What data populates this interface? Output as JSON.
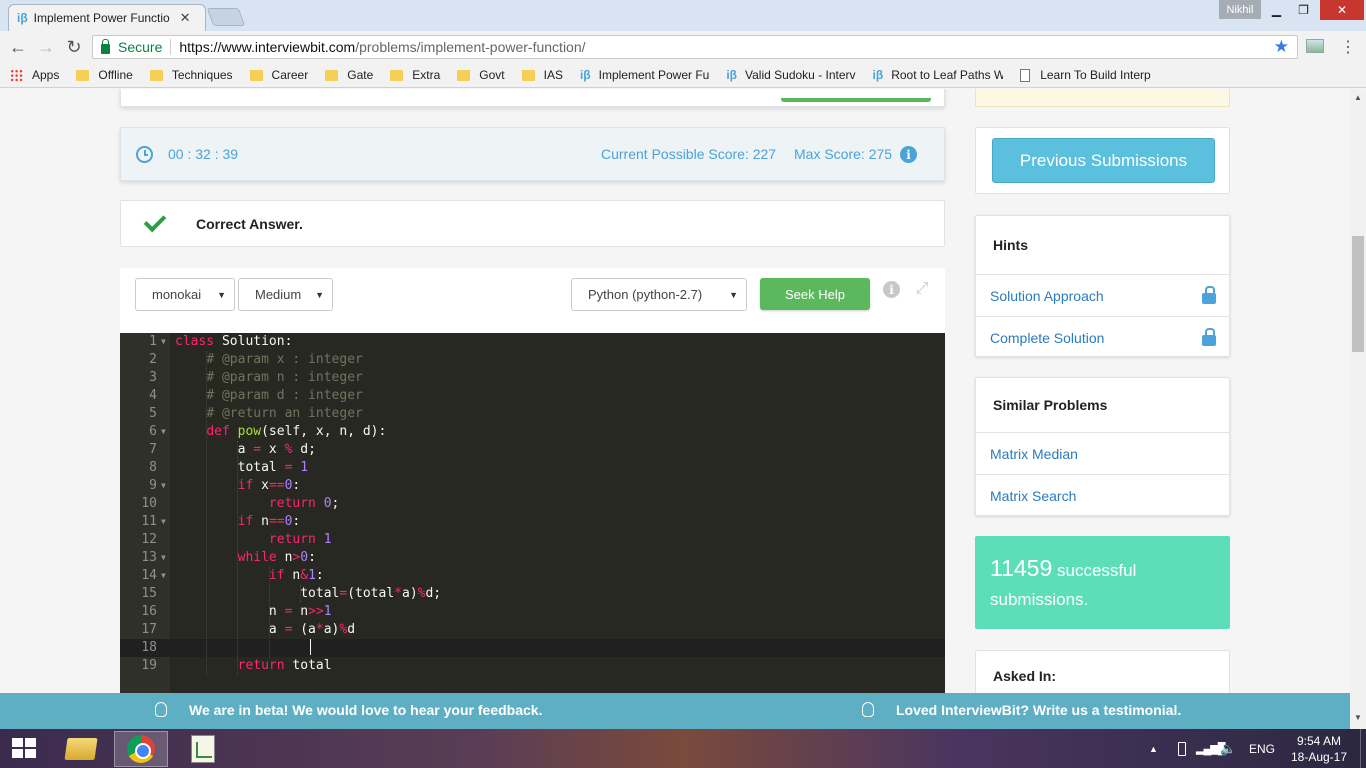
{
  "browser": {
    "tab_title": "Implement Power Functio",
    "tab_favicon": "iβ",
    "user_name": "Nikhil",
    "window_buttons": {
      "minimize": "▁",
      "maximize": "❐",
      "close": "✕"
    },
    "secure_label": "Secure",
    "url_host": "https://www.interviewbit.com",
    "url_path": "/problems/implement-power-function/",
    "bookmarks": [
      {
        "label": "Apps",
        "icon": "apps-icon"
      },
      {
        "label": "Offline",
        "icon": "folder-icon"
      },
      {
        "label": "Techniques",
        "icon": "folder-icon"
      },
      {
        "label": "Career",
        "icon": "folder-icon"
      },
      {
        "label": "Gate",
        "icon": "folder-icon"
      },
      {
        "label": "Extra",
        "icon": "folder-icon"
      },
      {
        "label": "Govt",
        "icon": "folder-icon"
      },
      {
        "label": "IAS",
        "icon": "folder-icon"
      },
      {
        "label": "Implement Power Fu",
        "icon": "ib-icon"
      },
      {
        "label": "Valid Sudoku - Interv",
        "icon": "ib-icon"
      },
      {
        "label": "Root to Leaf Paths W",
        "icon": "ib-icon"
      },
      {
        "label": "Learn To Build Interp",
        "icon": "page-icon"
      }
    ]
  },
  "timer": {
    "time": "00 : 32 : 39",
    "current_score": "Current Possible Score: 227",
    "max_score": "Max Score: 275"
  },
  "result": {
    "message": "Correct Answer."
  },
  "editor": {
    "theme": "monokai",
    "font_size": "Medium",
    "language": "Python (python-2.7)",
    "seek_help": "Seek Help",
    "lines": [
      "class Solution:",
      "    # @param x : integer",
      "    # @param n : integer",
      "    # @param d : integer",
      "    # @return an integer",
      "    def pow(self, x, n, d):",
      "        a = x % d;",
      "        total = 1",
      "        if x==0:",
      "            return 0;",
      "        if n==0:",
      "            return 1",
      "        while n>0:",
      "            if n&1:",
      "                total=(total*a)%d;",
      "            n = n>>1",
      "            a = (a*a)%d",
      "",
      "        return total"
    ]
  },
  "sidebar": {
    "previous_submissions": "Previous Submissions",
    "hints": {
      "title": "Hints",
      "items": [
        "Solution Approach",
        "Complete Solution"
      ]
    },
    "similar": {
      "title": "Similar Problems",
      "items": [
        "Matrix Median",
        "Matrix Search"
      ]
    },
    "success": {
      "count": "11459",
      "text_a": " successful",
      "text_b": "submissions."
    },
    "asked_in": "Asked In:"
  },
  "feedback": {
    "left": "We are in beta! We would love to hear your feedback.",
    "right": "Loved InterviewBit? Write us a testimonial."
  },
  "taskbar": {
    "language": "ENG",
    "time": "9:54 AM",
    "date": "18-Aug-17"
  },
  "colors": {
    "accent_blue": "#4aa3d9",
    "success_green": "#5cb85c",
    "success_card": "#5cdfb8",
    "feedback_bar": "#5fafc4",
    "editor_bg": "#272822"
  }
}
